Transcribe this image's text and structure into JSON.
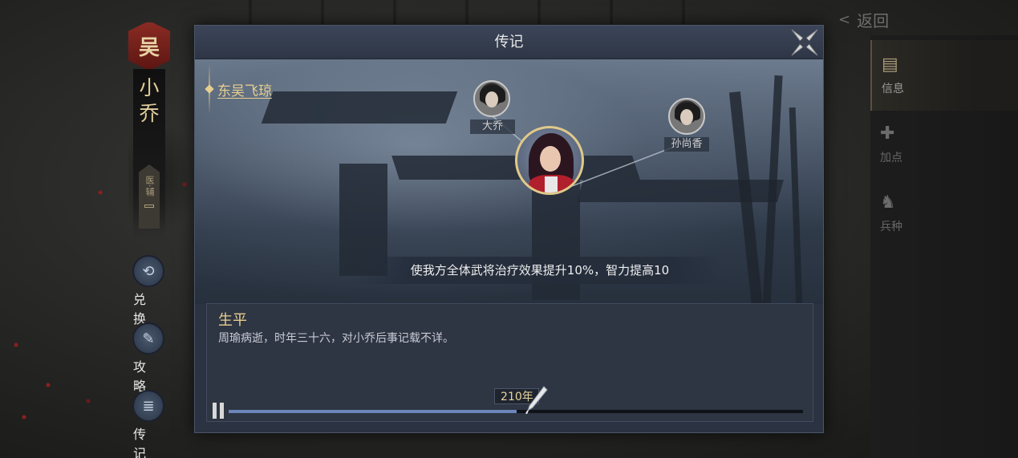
{
  "faction": {
    "badge": "吴",
    "name": "小乔",
    "role": "医·辅"
  },
  "side_menu": [
    {
      "label": "兑换",
      "icon": "exchange-icon"
    },
    {
      "label": "攻略",
      "icon": "scroll-icon"
    },
    {
      "label": "传记",
      "icon": "book-icon"
    }
  ],
  "back": {
    "label": "返回"
  },
  "right_tabs": [
    {
      "label": "信息",
      "icon": "scroll-icon",
      "active": true
    },
    {
      "label": "加点",
      "icon": "stats-icon",
      "active": false
    },
    {
      "label": "兵种",
      "icon": "soldier-icon",
      "active": false
    }
  ],
  "dialog": {
    "title": "传记",
    "story_branch": "东吴飞琼",
    "relations": [
      {
        "name": "大乔"
      },
      {
        "name": "孙尚香"
      }
    ],
    "effect": "使我方全体武将治疗效果提升10%，智力提高10",
    "bio": {
      "title": "生平",
      "text": "周瑜病逝，时年三十六，对小乔后事记载不详。"
    },
    "timeline": {
      "year_label": "210年",
      "progress": 0.502
    }
  },
  "colors": {
    "accent_gold": "#e6cf8f",
    "timeline_blue": "#6b86b8",
    "dialog_bg": "#2b3241"
  }
}
